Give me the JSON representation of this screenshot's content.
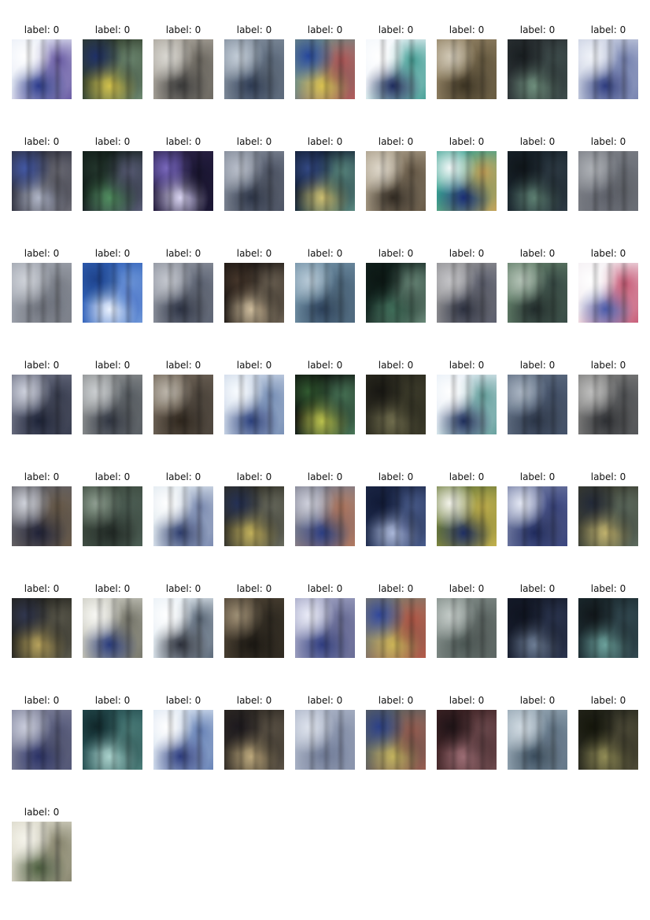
{
  "tiles": [
    {
      "label": "label: 0",
      "palette": {
        "bg": "#e9eef7",
        "a": "#2b3a8a",
        "b": "#ffffff",
        "c": "#6b5ca5"
      }
    },
    {
      "label": "label: 0",
      "palette": {
        "bg": "#2f3b2a",
        "a": "#d1c04a",
        "b": "#1b2a5a",
        "c": "#6f8b73"
      }
    },
    {
      "label": "label: 0",
      "palette": {
        "bg": "#a8a39a",
        "a": "#3a3a3a",
        "b": "#d2d0c9",
        "c": "#6f6b63"
      }
    },
    {
      "label": "label: 0",
      "palette": {
        "bg": "#7f8b9a",
        "a": "#2d3a52",
        "b": "#b7c3d0",
        "c": "#5d6b7d"
      }
    },
    {
      "label": "label: 0",
      "palette": {
        "bg": "#6f8b86",
        "a": "#d8c04e",
        "b": "#213e8c",
        "c": "#b35b5b"
      }
    },
    {
      "label": "label: 0",
      "palette": {
        "bg": "#f2f6fb",
        "a": "#1e2b5b",
        "b": "#ffffff",
        "c": "#4aa39a"
      }
    },
    {
      "label": "label: 0",
      "palette": {
        "bg": "#8f7f62",
        "a": "#3b3322",
        "b": "#c8bea8",
        "c": "#6a5d42"
      }
    },
    {
      "label": "label: 0",
      "palette": {
        "bg": "#2b3134",
        "a": "#6c8c7a",
        "b": "#151a1c",
        "c": "#3f4e4d"
      }
    },
    {
      "label": "label: 0",
      "palette": {
        "bg": "#c8cfe1",
        "a": "#2d3b7d",
        "b": "#eef1f8",
        "c": "#7a86b2"
      }
    },
    {
      "label": "label: 0",
      "palette": {
        "bg": "#2d2f3d",
        "a": "#aeb4c6",
        "b": "#3a4d92",
        "c": "#6d6d77"
      }
    },
    {
      "label": "label: 0",
      "palette": {
        "bg": "#0f1a16",
        "a": "#4f8b5d",
        "b": "#1d2d25",
        "c": "#5b5f7a"
      }
    },
    {
      "label": "label: 0",
      "palette": {
        "bg": "#2a2144",
        "a": "#d9d4f2",
        "b": "#6a5bb0",
        "c": "#1a1633"
      }
    },
    {
      "label": "label: 0",
      "palette": {
        "bg": "#7f8795",
        "a": "#2c3446",
        "b": "#aab1bf",
        "c": "#4e5566"
      }
    },
    {
      "label": "label: 0",
      "palette": {
        "bg": "#0f1b2f",
        "a": "#cbbd6f",
        "b": "#2c3f72",
        "c": "#5c8c83"
      }
    },
    {
      "label": "label: 0",
      "palette": {
        "bg": "#a79b86",
        "a": "#302921",
        "b": "#d7cfbf",
        "c": "#6a5c49"
      }
    },
    {
      "label": "label: 0",
      "palette": {
        "bg": "#3aa08f",
        "a": "#1a2d73",
        "b": "#eef6f6",
        "c": "#c8a55b"
      }
    },
    {
      "label": "label: 0",
      "palette": {
        "bg": "#17222a",
        "a": "#5b7d6f",
        "b": "#0d1216",
        "c": "#2e3b45"
      }
    },
    {
      "label": "label: 0",
      "palette": {
        "bg": "#7a7d84",
        "a": "#5d6069",
        "b": "#9ea2a8",
        "c": "#6b6f77"
      }
    },
    {
      "label": "label: 0",
      "palette": {
        "bg": "#9ea3ad",
        "a": "#6e727c",
        "b": "#c6cad2",
        "c": "#7f838c"
      }
    },
    {
      "label": "label: 0",
      "palette": {
        "bg": "#2f5fb8",
        "a": "#eaf2ff",
        "b": "#1a3a7a",
        "c": "#6f98d9"
      }
    },
    {
      "label": "label: 0",
      "palette": {
        "bg": "#8c919c",
        "a": "#2b3142",
        "b": "#b8bcc5",
        "c": "#5f6676"
      }
    },
    {
      "label": "label: 0",
      "palette": {
        "bg": "#1a1512",
        "a": "#cdbb9a",
        "b": "#3b2e24",
        "c": "#6e6354"
      }
    },
    {
      "label": "label: 0",
      "palette": {
        "bg": "#6f8ea3",
        "a": "#2b3f58",
        "b": "#a9bfcf",
        "c": "#4f6a80"
      }
    },
    {
      "label": "label: 0",
      "palette": {
        "bg": "#10201c",
        "a": "#3d6a56",
        "b": "#0a1411",
        "c": "#6b8b7b"
      }
    },
    {
      "label": "label: 0",
      "palette": {
        "bg": "#8f8f92",
        "a": "#2b2f3e",
        "b": "#b9b9bd",
        "c": "#5e6170"
      }
    },
    {
      "label": "label: 0",
      "palette": {
        "bg": "#5f7b66",
        "a": "#202a2a",
        "b": "#a5b7a8",
        "c": "#3a4d48"
      }
    },
    {
      "label": "label: 0",
      "palette": {
        "bg": "#f3eef2",
        "a": "#4b5aa8",
        "b": "#ffffff",
        "c": "#c95f7b"
      }
    },
    {
      "label": "label: 0",
      "palette": {
        "bg": "#6b6f81",
        "a": "#1c2236",
        "b": "#c5c9d7",
        "c": "#3a3f52"
      }
    },
    {
      "label": "label: 0",
      "palette": {
        "bg": "#8a8d8e",
        "a": "#2f3440",
        "b": "#c2c6c9",
        "c": "#5a6066"
      }
    },
    {
      "label": "label: 0",
      "palette": {
        "bg": "#6d6256",
        "a": "#2d251c",
        "b": "#b0a89b",
        "c": "#4e463d"
      }
    },
    {
      "label": "label: 0",
      "palette": {
        "bg": "#cdd8e8",
        "a": "#2b3f7a",
        "b": "#f7fbff",
        "c": "#7c93b8"
      }
    },
    {
      "label": "label: 0",
      "palette": {
        "bg": "#0c0f0d",
        "a": "#b9c04b",
        "b": "#2b4f2a",
        "c": "#4b7a5a"
      }
    },
    {
      "label": "label: 0",
      "palette": {
        "bg": "#2b2a1f",
        "a": "#6d6a4b",
        "b": "#151410",
        "c": "#3c3b2a"
      }
    },
    {
      "label": "label: 0",
      "palette": {
        "bg": "#e6eef6",
        "a": "#1e2d59",
        "b": "#ffffff",
        "c": "#6aa3a0"
      }
    },
    {
      "label": "label: 0",
      "palette": {
        "bg": "#5e6c80",
        "a": "#2a3446",
        "b": "#9aa7b8",
        "c": "#44526a"
      }
    },
    {
      "label": "label: 0",
      "palette": {
        "bg": "#7b7b7a",
        "a": "#2d2f33",
        "b": "#b3b3b2",
        "c": "#55575a"
      }
    },
    {
      "label": "label: 0",
      "palette": {
        "bg": "#5f5f66",
        "a": "#1f2136",
        "b": "#c8cbd5",
        "c": "#6b5c4a"
      }
    },
    {
      "label": "label: 0",
      "palette": {
        "bg": "#3d4a3f",
        "a": "#202824",
        "b": "#7d8c7f",
        "c": "#4d5f55"
      }
    },
    {
      "label": "label: 0",
      "palette": {
        "bg": "#dfe8ef",
        "a": "#2d3c6b",
        "b": "#ffffff",
        "c": "#7e8db2"
      }
    },
    {
      "label": "label: 0",
      "palette": {
        "bg": "#2f2e25",
        "a": "#c0ae58",
        "b": "#1f2a4a",
        "c": "#6a6c5f"
      }
    },
    {
      "label": "label: 0",
      "palette": {
        "bg": "#7a7c8c",
        "a": "#2b3d80",
        "b": "#c6c8d6",
        "c": "#b27b62"
      }
    },
    {
      "label": "label: 0",
      "palette": {
        "bg": "#1b2747",
        "a": "#aab7d9",
        "b": "#0f1730",
        "c": "#4a5d8e"
      }
    },
    {
      "label": "label: 0",
      "palette": {
        "bg": "#6b7a3a",
        "a": "#1e2d61",
        "b": "#f2f2e8",
        "c": "#c3b24f"
      }
    },
    {
      "label": "label: 0",
      "palette": {
        "bg": "#6e78a0",
        "a": "#1f2a5c",
        "b": "#dfe4f2",
        "c": "#3b4680"
      }
    },
    {
      "label": "label: 0",
      "palette": {
        "bg": "#3a3c30",
        "a": "#bfb06b",
        "b": "#1e2431",
        "c": "#5f6d60"
      }
    },
    {
      "label": "label: 0",
      "palette": {
        "bg": "#21211c",
        "a": "#b5a05a",
        "b": "#2a2f44",
        "c": "#5c5a4d"
      }
    },
    {
      "label": "label: 0",
      "palette": {
        "bg": "#c9c9bf",
        "a": "#283a7a",
        "b": "#f7f7f2",
        "c": "#7a7a6e"
      }
    },
    {
      "label": "label: 0",
      "palette": {
        "bg": "#e7eff5",
        "a": "#2b2f3a",
        "b": "#ffffff",
        "c": "#5c6a7a"
      }
    },
    {
      "label": "label: 0",
      "palette": {
        "bg": "#4a4032",
        "a": "#1a1712",
        "b": "#8b7d66",
        "c": "#2f2a21"
      }
    },
    {
      "label": "label: 0",
      "palette": {
        "bg": "#9fa2c2",
        "a": "#2f3c7e",
        "b": "#e6e8f6",
        "c": "#6b6f98"
      }
    },
    {
      "label": "label: 0",
      "palette": {
        "bg": "#7d7b6c",
        "a": "#cbb355",
        "b": "#2b3f8b",
        "c": "#b55b49"
      }
    },
    {
      "label": "label: 0",
      "palette": {
        "bg": "#7f8a86",
        "a": "#4a5552",
        "b": "#b8c1bd",
        "c": "#5d6764"
      }
    },
    {
      "label": "label: 0",
      "palette": {
        "bg": "#151b2a",
        "a": "#6b7b92",
        "b": "#0d111c",
        "c": "#2b3550"
      }
    },
    {
      "label": "label: 0",
      "palette": {
        "bg": "#1b2a2f",
        "a": "#6aa09a",
        "b": "#0f1417",
        "c": "#334a52"
      }
    },
    {
      "label": "label: 0",
      "palette": {
        "bg": "#7b7e96",
        "a": "#2a3164",
        "b": "#bfc3d5",
        "c": "#55597a"
      }
    },
    {
      "label": "label: 0",
      "palette": {
        "bg": "#244c4f",
        "a": "#a9d2cc",
        "b": "#0e2225",
        "c": "#4c7f7b"
      }
    },
    {
      "label": "label: 0",
      "palette": {
        "bg": "#dce6f2",
        "a": "#2c3b7c",
        "b": "#ffffff",
        "c": "#6a85b8"
      }
    },
    {
      "label": "label: 0",
      "palette": {
        "bg": "#2e2923",
        "a": "#bca77a",
        "b": "#19161a",
        "c": "#5c5346"
      }
    },
    {
      "label": "label: 0",
      "palette": {
        "bg": "#aab3c6",
        "a": "#6f7a96",
        "b": "#d7dde9",
        "c": "#8b95ad"
      }
    },
    {
      "label": "label: 0",
      "palette": {
        "bg": "#5b6160",
        "a": "#c2b25c",
        "b": "#263877",
        "c": "#9a5f52"
      }
    },
    {
      "label": "label: 0",
      "palette": {
        "bg": "#3f2325",
        "a": "#9a6b72",
        "b": "#1b1114",
        "c": "#6f4b4f"
      }
    },
    {
      "label": "label: 0",
      "palette": {
        "bg": "#93a4b1",
        "a": "#394b5b",
        "b": "#c7d3dc",
        "c": "#667a8b"
      }
    },
    {
      "label": "label: 0",
      "palette": {
        "bg": "#24251c",
        "a": "#8f8a54",
        "b": "#121309",
        "c": "#4f4c38"
      }
    },
    {
      "label": "label: 0",
      "palette": {
        "bg": "#d9d7c8",
        "a": "#4b5d3e",
        "b": "#f4f2e8",
        "c": "#8c8a73"
      }
    }
  ]
}
